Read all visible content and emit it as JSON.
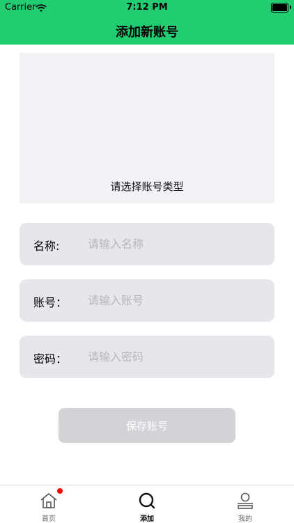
{
  "status": {
    "carrier": "Carrier",
    "time": "7:12 PM"
  },
  "nav": {
    "title": "添加新账号"
  },
  "type_picker": {
    "label": "请选择账号类型"
  },
  "fields": {
    "name": {
      "label": "名称:",
      "placeholder": "请输入名称"
    },
    "account": {
      "label": "账号：",
      "placeholder": "请输入账号"
    },
    "password": {
      "label": "密码：",
      "placeholder": "请输入密码"
    }
  },
  "save": {
    "label": "保存账号"
  },
  "tabbar": {
    "items": [
      {
        "label": "首页",
        "icon": "home-icon",
        "badge": true
      },
      {
        "label": "添加",
        "icon": "search-icon",
        "active": true
      },
      {
        "label": "我的",
        "icon": "profile-icon"
      }
    ]
  },
  "colors": {
    "header": "#22cd71",
    "badge": "#ff0000"
  }
}
